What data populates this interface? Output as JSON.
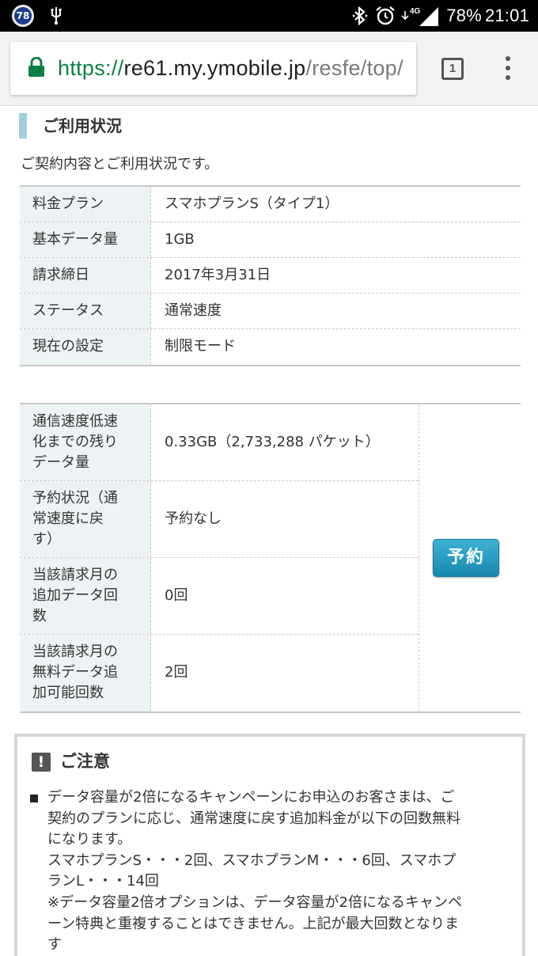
{
  "status_bar": {
    "notification_badge": "78",
    "battery": "78%",
    "time": "21:01",
    "network": "4G",
    "icons": [
      "usb-icon",
      "bluetooth-icon",
      "alarm-icon",
      "signal-icon"
    ]
  },
  "browser": {
    "url_scheme": "https://",
    "url_host": "re61.my.ymobile.jp",
    "url_path": "/resfe/top/",
    "tab_count": "1"
  },
  "section": {
    "title": "ご利用状況",
    "description": "ご契約内容とご利用状況です。"
  },
  "plan_info": [
    {
      "label": "料金プラン",
      "value": "スマホプランS（タイプ1）"
    },
    {
      "label": "基本データ量",
      "value": "1GB"
    },
    {
      "label": "請求締日",
      "value": "2017年3月31日"
    },
    {
      "label": "ステータス",
      "value": "通常速度"
    },
    {
      "label": "現在の設定",
      "value": "制限モード"
    }
  ],
  "usage": [
    {
      "label_lines": [
        "通信速度低速",
        "化までの残り",
        "データ量"
      ],
      "value": "0.33GB（2,733,288 パケット）"
    },
    {
      "label_lines": [
        "予約状況（通",
        "常速度に戻",
        "す）"
      ],
      "value": "予約なし"
    },
    {
      "label_lines": [
        "当該請求月の",
        "追加データ回",
        "数"
      ],
      "value": "0回"
    },
    {
      "label_lines": [
        "当該請求月の",
        "無料データ追",
        "加可能回数"
      ],
      "value": "2回"
    }
  ],
  "reserve_button_label": "予約",
  "notice": {
    "icon": "!",
    "title": "ご注意",
    "lines": [
      "データ容量が2倍になるキャンペーンにお申込のお客さまは、ご",
      "契約のプランに応じ、通常速度に戻す追加料金が以下の回数無料",
      "になります。",
      "スマホプランS・・・2回、スマホプランM・・・6回、スマホプ",
      "ランL・・・14回",
      "※データ容量2倍オプションは、データ容量が2倍になるキャンペ",
      "ーン特典と重複することはできません。上記が最大回数となりま",
      "す"
    ]
  },
  "colors": {
    "status_bar": "#000000",
    "url_scheme": "#0b8043",
    "label_cell_bg": "#edf3f4",
    "accent_bar": "#9dd0dc",
    "button": "#1f96bf"
  }
}
